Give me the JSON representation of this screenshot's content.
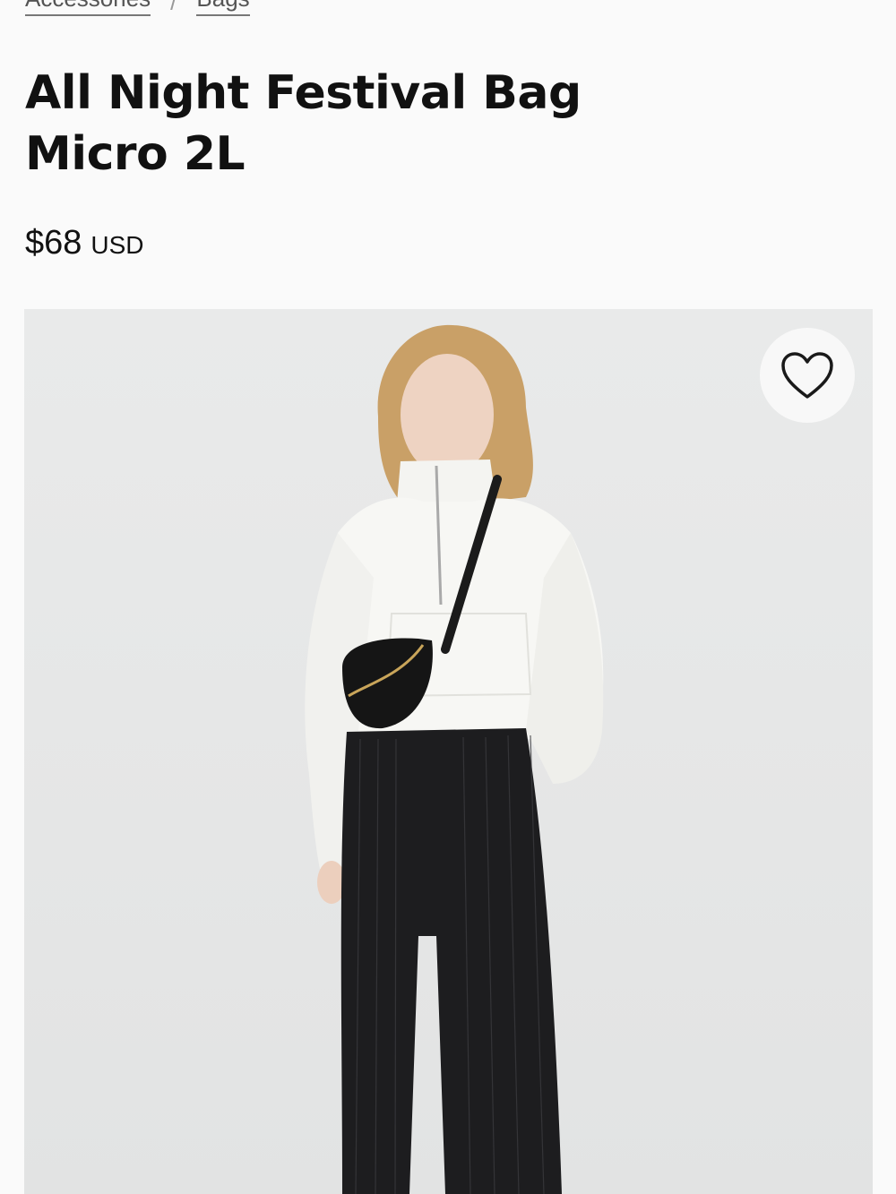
{
  "breadcrumb": {
    "items": [
      {
        "label": "Accessories"
      },
      {
        "label": "Bags"
      }
    ],
    "separator": "/"
  },
  "product": {
    "title_line1": "All Night Festival Bag",
    "title_line2": "Micro 2L",
    "price": "$68",
    "currency": "USD"
  },
  "image": {
    "alt": "Model wearing white half-zip sweatshirt, black pinstripe wide-leg trousers and black crossbody belt bag"
  },
  "icons": {
    "wishlist": "heart-outline-icon"
  },
  "colors": {
    "background": "#fafafa",
    "text": "#111111",
    "image_bg": "#e7e8e8"
  }
}
